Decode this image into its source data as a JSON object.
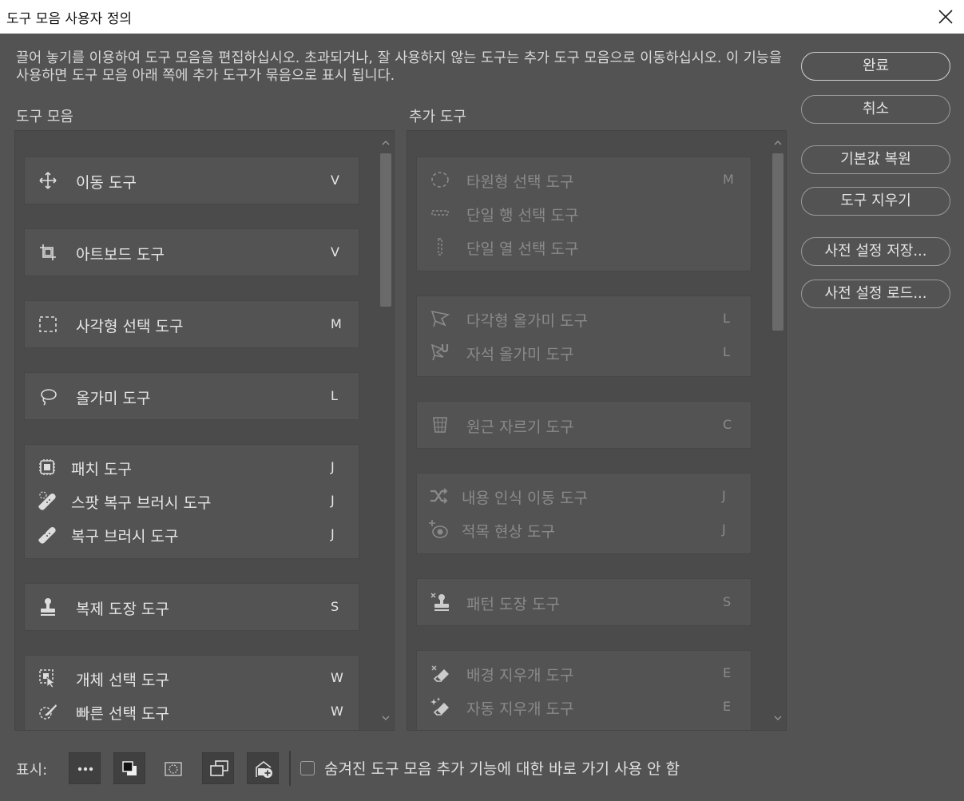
{
  "window": {
    "title": "도구 모음 사용자 정의"
  },
  "description": "끌어 놓기를 이용하여 도구 모음을 편집하십시오. 초과되거나, 잘 사용하지 않는 도구는 추가 도구 모음으로 이동하십시오. 이 기능을 사용하면 도구 모음 아래 쪽에 추가 도구가 묶음으로 표시 됩니다.",
  "buttons": {
    "done": "완료",
    "cancel": "취소",
    "restore_defaults": "기본값 복원",
    "clear_tools": "도구 지우기",
    "save_preset": "사전 설정 저장...",
    "load_preset": "사전 설정 로드..."
  },
  "toolbar_panel": {
    "label": "도구 모음",
    "groups": [
      {
        "tools": [
          {
            "icon": "move-icon",
            "label": "이동 도구",
            "key": "V"
          }
        ]
      },
      {
        "tools": [
          {
            "icon": "artboard-icon",
            "label": "아트보드 도구",
            "key": "V"
          }
        ]
      },
      {
        "tools": [
          {
            "icon": "rect-marquee-icon",
            "label": "사각형 선택 도구",
            "key": "M"
          }
        ]
      },
      {
        "tools": [
          {
            "icon": "lasso-icon",
            "label": "올가미 도구",
            "key": "L"
          }
        ]
      },
      {
        "tools": [
          {
            "icon": "patch-icon",
            "label": "패치 도구",
            "key": "J"
          },
          {
            "icon": "spot-healing-icon",
            "label": "스팟 복구 브러시 도구",
            "key": "J"
          },
          {
            "icon": "healing-brush-icon",
            "label": "복구 브러시 도구",
            "key": "J"
          }
        ]
      },
      {
        "tools": [
          {
            "icon": "clone-stamp-icon",
            "label": "복제 도장 도구",
            "key": "S"
          }
        ]
      },
      {
        "tools": [
          {
            "icon": "object-select-icon",
            "label": "개체 선택 도구",
            "key": "W"
          },
          {
            "icon": "quick-select-icon",
            "label": "빠른 선택 도구",
            "key": "W"
          }
        ]
      }
    ]
  },
  "extra_panel": {
    "label": "추가 도구",
    "groups": [
      {
        "tools": [
          {
            "icon": "ellipse-marquee-icon",
            "label": "타원형 선택 도구",
            "key": "M"
          },
          {
            "icon": "single-row-marquee-icon",
            "label": "단일 행 선택 도구",
            "key": ""
          },
          {
            "icon": "single-column-marquee-icon",
            "label": "단일 열 선택 도구",
            "key": ""
          }
        ]
      },
      {
        "tools": [
          {
            "icon": "polygonal-lasso-icon",
            "label": "다각형 올가미 도구",
            "key": "L"
          },
          {
            "icon": "magnetic-lasso-icon",
            "label": "자석 올가미 도구",
            "key": "L"
          }
        ]
      },
      {
        "tools": [
          {
            "icon": "perspective-crop-icon",
            "label": "원근 자르기 도구",
            "key": "C"
          }
        ]
      },
      {
        "tools": [
          {
            "icon": "content-aware-move-icon",
            "label": "내용 인식 이동 도구",
            "key": "J"
          },
          {
            "icon": "red-eye-icon",
            "label": "적목 현상 도구",
            "key": "J"
          }
        ]
      },
      {
        "tools": [
          {
            "icon": "pattern-stamp-icon",
            "label": "패턴 도장 도구",
            "key": "S"
          }
        ]
      },
      {
        "tools": [
          {
            "icon": "background-eraser-icon",
            "label": "배경 지우개 도구",
            "key": "E"
          },
          {
            "icon": "magic-eraser-icon",
            "label": "자동 지우개 도구",
            "key": "E"
          }
        ]
      }
    ]
  },
  "footer": {
    "show_label": "표시:",
    "view_buttons": [
      "more-icon",
      "fg-bg-color-icon",
      "quick-mask-icon",
      "screen-mode-icon",
      "edit-toolbar-icon"
    ],
    "checkbox_label": "숨겨진 도구 모음 추가 기능에 대한 바로 가기 사용 안 함",
    "checkbox_checked": false
  }
}
